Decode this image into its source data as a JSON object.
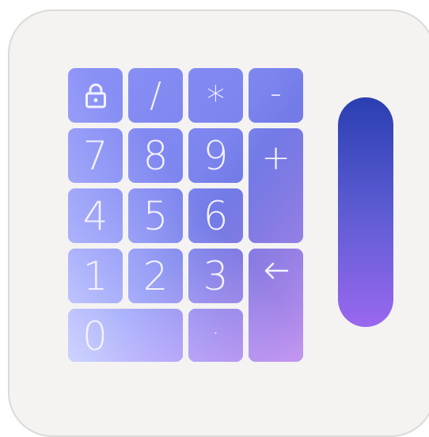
{
  "keypad": {
    "keys": {
      "lock": "lock-icon",
      "divide": "/",
      "multiply": "*",
      "minus": "-",
      "seven": "7",
      "eight": "8",
      "nine": "9",
      "plus": "+",
      "four": "4",
      "five": "5",
      "six": "6",
      "one": "1",
      "two": "2",
      "three": "3",
      "enter": "←",
      "zero": "0",
      "dot": "·"
    }
  },
  "colors": {
    "card_bg": "#f4f3f1",
    "key_top": "#8b92f7",
    "key_bottom_left": "#cfd3ff",
    "key_bottom_right": "#daa0f8",
    "slider_top": "#2a3fb0",
    "slider_bottom": "#9a68ee"
  }
}
